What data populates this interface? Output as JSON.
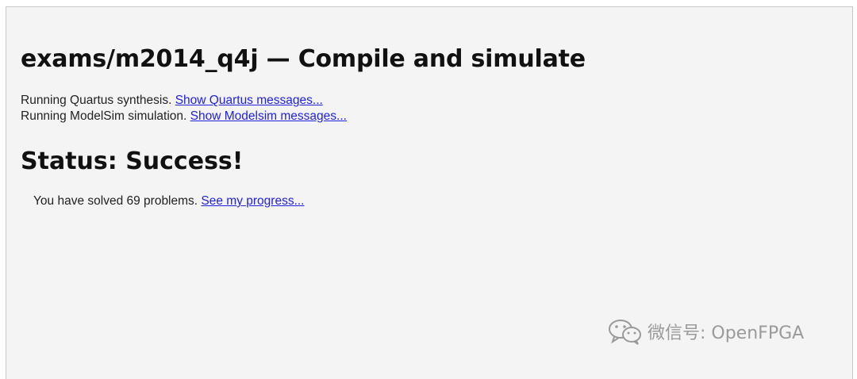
{
  "page": {
    "title": "exams/m2014_q4j — Compile and simulate"
  },
  "messages": [
    {
      "text": "Running Quartus synthesis. ",
      "link_label": "Show Quartus messages..."
    },
    {
      "text": "Running ModelSim simulation. ",
      "link_label": "Show Modelsim messages..."
    }
  ],
  "status": {
    "heading": "Status: Success!",
    "solved_text": "You have solved 69 problems. ",
    "progress_link": "See my progress..."
  },
  "watermark": {
    "text": "微信号: OpenFPGA",
    "icon": "wechat-icon"
  }
}
